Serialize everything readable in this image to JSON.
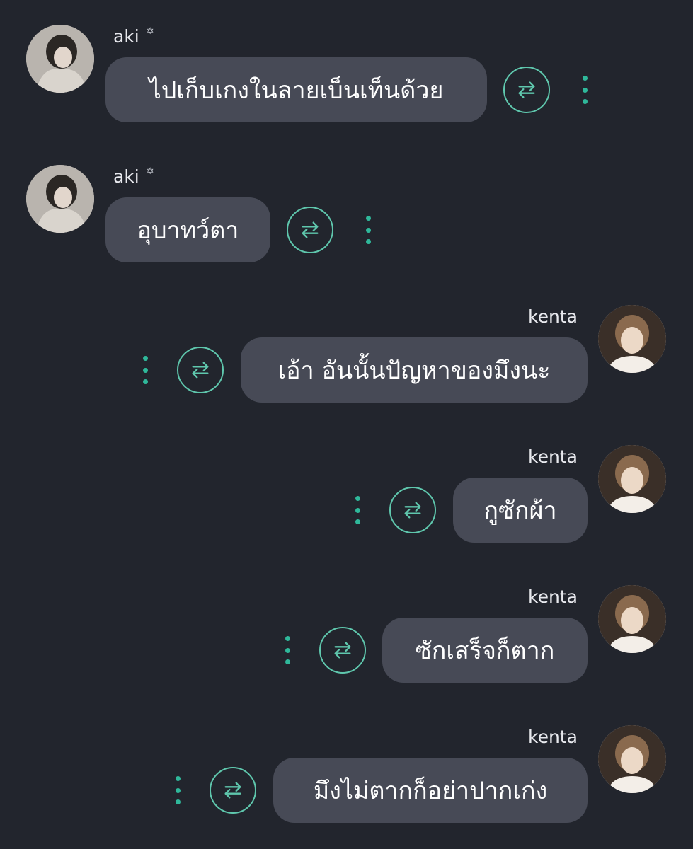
{
  "colors": {
    "background": "#22252d",
    "bubble": "#474a56",
    "accent": "#5fc7ad",
    "text": "#ffffff"
  },
  "messages": [
    {
      "sender": "aki",
      "side": "left",
      "star": "✡",
      "text": "ไปเก็บเกงในลายเบ็นเท็นด้วย"
    },
    {
      "sender": "aki",
      "side": "left",
      "star": "✡",
      "text": "อุบาทว์ตา"
    },
    {
      "sender": "kenta",
      "side": "right",
      "text": "เอ้า อันนั้นปัญหาของมึงนะ"
    },
    {
      "sender": "kenta",
      "side": "right",
      "text": "กูซักผ้า"
    },
    {
      "sender": "kenta",
      "side": "right",
      "text": "ซักเสร็จก็ตาก"
    },
    {
      "sender": "kenta",
      "side": "right",
      "text": "มึงไม่ตากก็อย่าปากเก่ง"
    }
  ],
  "icons": {
    "translate": "swap-arrows-icon",
    "more": "more-vertical-icon"
  }
}
